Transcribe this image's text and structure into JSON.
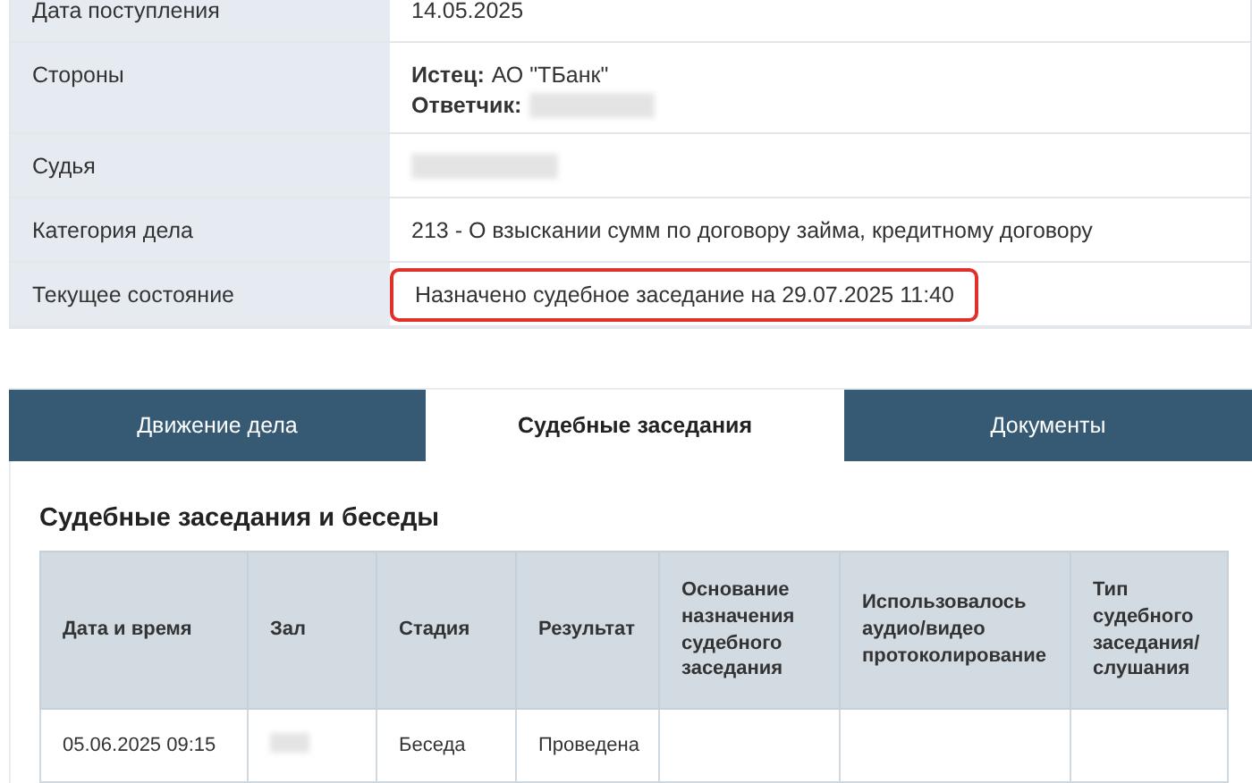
{
  "case_info": [
    {
      "kind": "text",
      "label": "Дата поступления",
      "value": "14.05.2025"
    },
    {
      "kind": "parties",
      "label": "Стороны",
      "parties": [
        {
          "role": "Истец:",
          "name": "АО \"ТБанк\"",
          "redacted": false
        },
        {
          "role": "Ответчик:",
          "redacted": true
        }
      ]
    },
    {
      "kind": "redacted",
      "label": "Судья"
    },
    {
      "kind": "text",
      "label": "Категория дела",
      "value": "213 - О взыскании сумм по договору займа, кредитному договору"
    },
    {
      "kind": "highlighted",
      "label": "Текущее состояние",
      "value": "Назначено судебное заседание на 29.07.2025 11:40"
    }
  ],
  "tabs": [
    {
      "label": "Движение дела",
      "selected": false
    },
    {
      "label": "Судебные заседания",
      "selected": true
    },
    {
      "label": "Документы",
      "selected": false
    }
  ],
  "section_title": "Судебные заседания и беседы",
  "table": {
    "columns": [
      "Дата и время",
      "Зал",
      "Стадия",
      "Результат",
      "Основание назначения судебного заседания",
      "Использовалось аудио/видео протоколирование",
      "Тип судебного заседания/ слушания"
    ],
    "rows": [
      [
        {
          "text": "05.06.2025 09:15"
        },
        {
          "redacted": true
        },
        {
          "text": "Беседа"
        },
        {
          "text": "Проведена"
        },
        null,
        null,
        null
      ]
    ]
  }
}
